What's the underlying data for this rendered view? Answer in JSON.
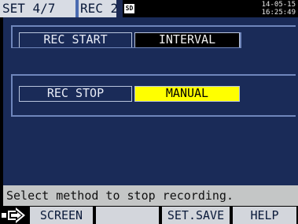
{
  "header": {
    "set_label": "SET  4/7",
    "rec_label": "REC  2",
    "sd_icon_text": "SD",
    "date": "14-05-15",
    "time": "16:25:49"
  },
  "settings": [
    {
      "label": "REC START",
      "value": "INTERVAL",
      "value_bg": "#000000",
      "value_color": "#f0f0f0"
    },
    {
      "label": "REC STOP",
      "value": "MANUAL",
      "value_bg": "#ffff00",
      "value_color": "#000000"
    }
  ],
  "message": "Select method to stop recording.",
  "footer": {
    "keys": [
      "SCREEN",
      "",
      "SET.SAVE",
      "HELP"
    ],
    "arrow_icon": "arrow-right-icon"
  },
  "colors": {
    "panel": "#1a2b58",
    "header_tab": "#d8dce4",
    "highlight": "#ffff00",
    "message_bar": "#c4c6c6"
  }
}
